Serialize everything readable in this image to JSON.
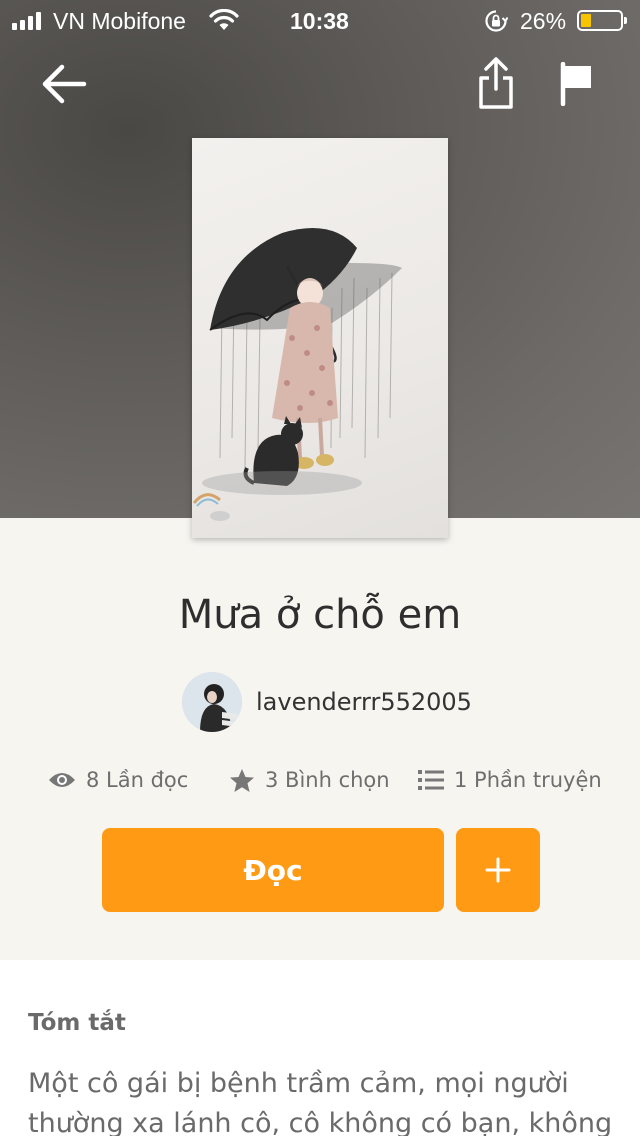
{
  "status_bar": {
    "carrier": "VN Mobifone",
    "time": "10:38",
    "battery_percent": "26%",
    "battery_level": 0.26,
    "battery_color": "#f7c400"
  },
  "nav": {
    "back_icon": "arrow-left-icon",
    "share_icon": "share-icon",
    "report_icon": "flag-icon"
  },
  "story": {
    "title": "Mưa ở chỗ em",
    "author": "lavenderrr552005",
    "reads": "8 Lần đọc",
    "votes": "3 Bình chọn",
    "parts": "1 Phần truyện"
  },
  "actions": {
    "read_label": "Đọc",
    "add_icon": "plus-icon",
    "accent_color": "#ff9a14"
  },
  "summary": {
    "heading": "Tóm tắt",
    "text": "Một cô gái bị bệnh trầm cảm, mọi người thường xa lánh cô, cô không có bạn, không"
  }
}
